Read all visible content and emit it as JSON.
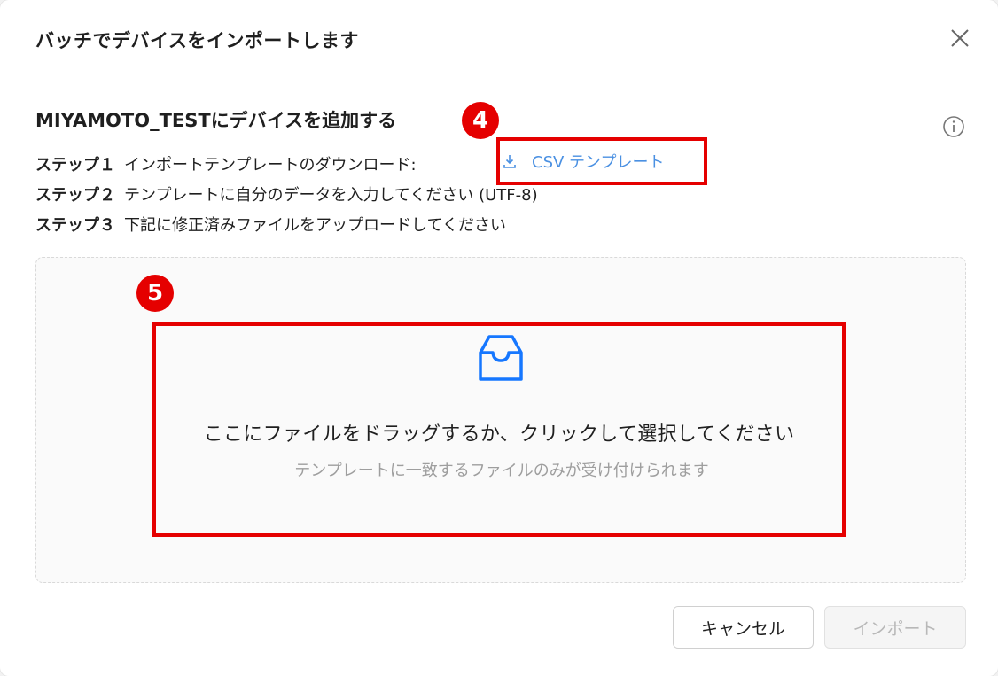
{
  "modal": {
    "title": "バッチでデバイスをインポートします",
    "section_title": "MIYAMOTO_TESTにデバイスを追加する"
  },
  "steps": [
    {
      "label": "ステップ１",
      "text": "インポートテンプレートのダウンロード:"
    },
    {
      "label": "ステップ２",
      "text": "テンプレートに自分のデータを入力してください (UTF-8)"
    },
    {
      "label": "ステップ３",
      "text": "下記に修正済みファイルをアップロードしてください"
    }
  ],
  "csv_link": {
    "label": "CSV テンプレート",
    "icon": "download-icon"
  },
  "dropzone": {
    "icon": "inbox-icon",
    "text": "ここにファイルをドラッグするか、クリックして選択してください",
    "hint": "テンプレートに一致するファイルのみが受け付けられます"
  },
  "annotations": {
    "badge4": "4",
    "badge5": "5"
  },
  "buttons": {
    "cancel": "キャンセル",
    "import": "インポート"
  },
  "colors": {
    "link": "#4a90e2",
    "icon": "#1677ff",
    "highlight": "#e50000"
  }
}
